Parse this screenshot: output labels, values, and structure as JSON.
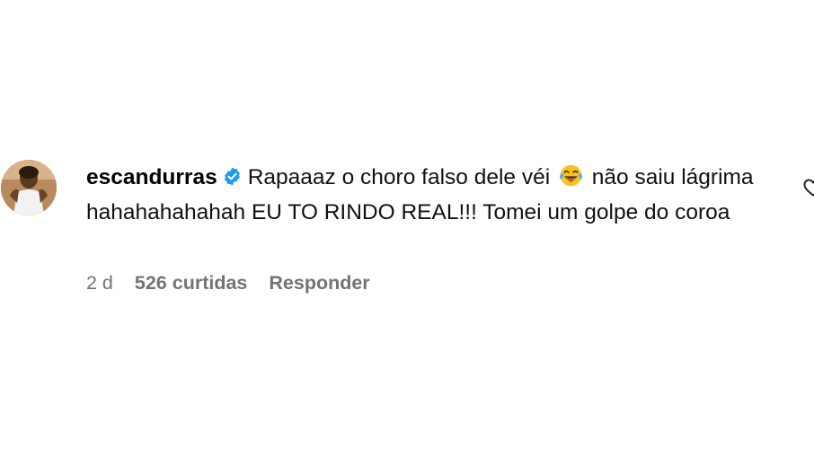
{
  "comment": {
    "username": "escandurras",
    "verified_icon": "verified-badge-icon",
    "text_part1": "Rapaaaz o choro falso dele véi",
    "emoji": "face-with-tears-of-joy",
    "text_part2": "não saiu lágrima hahahahahahah EU TO RINDO REAL!!! Tomei um golpe do coroa",
    "age": "2 d",
    "likes": "526 curtidas",
    "reply_label": "Responder",
    "like_icon": "heart-outline-icon",
    "colors": {
      "verified": "#1d9bf0",
      "meta_text": "#737373"
    }
  }
}
